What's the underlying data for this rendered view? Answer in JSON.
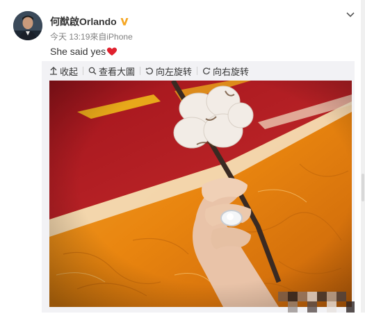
{
  "post": {
    "username": "何猷啟Orlando",
    "time": "今天 13:19",
    "source": "來自iPhone",
    "text": "She said yes"
  },
  "toolbar": {
    "collapse": "收起",
    "view_large": "查看大圖",
    "rotate_left": "向左旋转",
    "rotate_right": "向右旋转"
  },
  "icons": {
    "verified": "verified-v-icon",
    "menu": "chevron-down-icon",
    "heart": "heart-icon",
    "collapse": "arrow-up-icon",
    "view": "search-icon",
    "rotate_left": "rotate-left-icon",
    "rotate_right": "rotate-right-icon"
  },
  "colors": {
    "verified": "#f5a623",
    "heart": "#e0212e",
    "photo_red": "#b41e26",
    "photo_orange": "#e9850f"
  }
}
